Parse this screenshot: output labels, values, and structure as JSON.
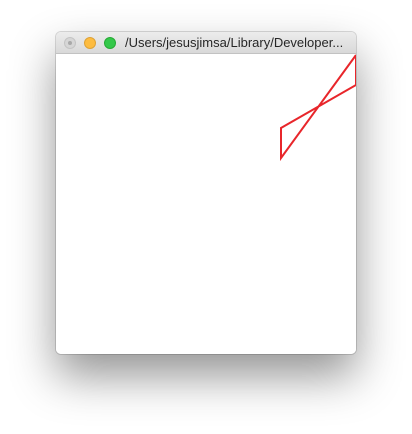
{
  "window": {
    "title": "/Users/jesusjimsa/Library/Developer..."
  },
  "drawing": {
    "stroke_color": "#e8262b",
    "shape": "bowtie-polyline"
  }
}
